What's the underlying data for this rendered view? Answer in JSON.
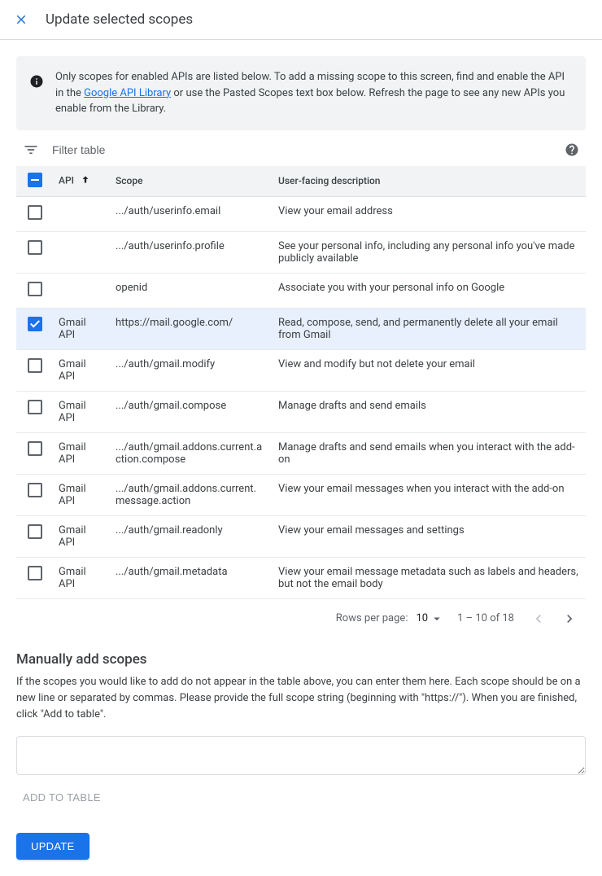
{
  "header": {
    "title": "Update selected scopes"
  },
  "info": {
    "text_before_link": "Only scopes for enabled APIs are listed below. To add a missing scope to this screen, find and enable the API in the ",
    "link_text": "Google API Library",
    "text_after_link": " or use the Pasted Scopes text box below. Refresh the page to see any new APIs you enable from the Library."
  },
  "filter": {
    "placeholder": "Filter table"
  },
  "table": {
    "columns": {
      "api": "API",
      "scope": "Scope",
      "description": "User-facing description"
    },
    "rows": [
      {
        "checked": false,
        "api": "",
        "scope": ".../auth/userinfo.email",
        "description": "View your email address"
      },
      {
        "checked": false,
        "api": "",
        "scope": ".../auth/userinfo.profile",
        "description": "See your personal info, including any personal info you've made publicly available"
      },
      {
        "checked": false,
        "api": "",
        "scope": "openid",
        "description": "Associate you with your personal info on Google"
      },
      {
        "checked": true,
        "api": "Gmail API",
        "scope": "https://mail.google.com/",
        "description": "Read, compose, send, and permanently delete all your email from Gmail"
      },
      {
        "checked": false,
        "api": "Gmail API",
        "scope": ".../auth/gmail.modify",
        "description": "View and modify but not delete your email"
      },
      {
        "checked": false,
        "api": "Gmail API",
        "scope": ".../auth/gmail.compose",
        "description": "Manage drafts and send emails"
      },
      {
        "checked": false,
        "api": "Gmail API",
        "scope": ".../auth/gmail.addons.current.action.compose",
        "description": "Manage drafts and send emails when you interact with the add-on"
      },
      {
        "checked": false,
        "api": "Gmail API",
        "scope": ".../auth/gmail.addons.current.message.action",
        "description": "View your email messages when you interact with the add-on"
      },
      {
        "checked": false,
        "api": "Gmail API",
        "scope": ".../auth/gmail.readonly",
        "description": "View your email messages and settings"
      },
      {
        "checked": false,
        "api": "Gmail API",
        "scope": ".../auth/gmail.metadata",
        "description": "View your email message metadata such as labels and headers, but not the email body"
      }
    ]
  },
  "pagination": {
    "rows_per_page_label": "Rows per page:",
    "rows_per_page_value": "10",
    "range": "1 – 10 of 18"
  },
  "manual": {
    "title": "Manually add scopes",
    "description": "If the scopes you would like to add do not appear in the table above, you can enter them here. Each scope should be on a new line or separated by commas. Please provide the full scope string (beginning with \"https://\"). When you are finished, click \"Add to table\".",
    "add_button": "ADD TO TABLE"
  },
  "footer": {
    "update_button": "UPDATE"
  }
}
